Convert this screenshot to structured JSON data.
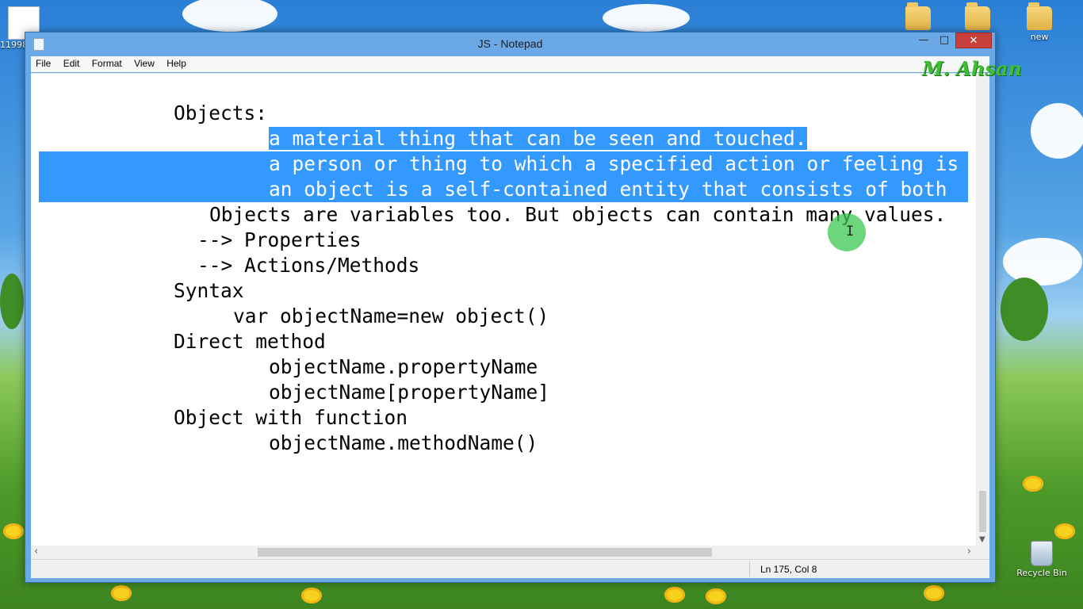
{
  "desktop": {
    "icons": [
      {
        "label": "11998"
      },
      {
        "label": ""
      },
      {
        "label": ""
      },
      {
        "label": "new"
      },
      {
        "label": "Recycle Bin"
      }
    ]
  },
  "window": {
    "title": "JS - Notepad",
    "controls": {
      "minimize": "—",
      "maximize": "□",
      "close": "✕"
    }
  },
  "menu": {
    "file": "File",
    "edit": "Edit",
    "format": "Format",
    "view": "View",
    "help": "Help"
  },
  "watermark": "M. Ahsan",
  "editor": {
    "lines": [
      "Objects:",
      "a material thing that can be seen and touched.",
      "a person or thing to which a specified action or feeling is",
      "an object is a self-contained entity that consists of both",
      "Objects are variables too. But objects can contain many values.",
      "--> Properties",
      "--> Actions/Methods",
      "Syntax",
      "var objectName=new object()",
      "Direct method",
      "objectName.propertyName",
      "objectName[propertyName]",
      "Object with function",
      "objectName.methodName()"
    ]
  },
  "status": {
    "position": "Ln 175, Col 8"
  },
  "icons": {
    "app": "notepad-icon",
    "ibeam": "text-cursor-icon",
    "scroll_left": "chevron-left-icon",
    "scroll_right": "chevron-right-icon",
    "scroll_down": "chevron-down-icon"
  },
  "colors": {
    "selection": "#3399ff",
    "close_button": "#c7413a",
    "watermark": "#3fbf35"
  }
}
